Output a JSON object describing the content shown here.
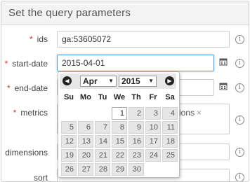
{
  "panel": {
    "title": "Set the query parameters"
  },
  "rows": {
    "ids": {
      "label": "ids",
      "value": "ga:53605072"
    },
    "start_date": {
      "label": "start-date",
      "value": "2015-04-01"
    },
    "end_date": {
      "label": "end-date",
      "value": ""
    },
    "metrics": {
      "label": "metrics",
      "chip": "ions",
      "chip_remove": "×"
    },
    "dimensions": {
      "label": "dimensions",
      "value": ""
    },
    "sort": {
      "label": "sort",
      "value": ""
    }
  },
  "required_marker": "*",
  "info_glyph": "i",
  "calendar_icon": "calendar-icon",
  "datepicker": {
    "month": "Apr",
    "year": "2015",
    "prev": "◀",
    "next": "▶",
    "dropdown_arrow": "▼",
    "weekdays": [
      "Su",
      "Mo",
      "Tu",
      "We",
      "Th",
      "Fr",
      "Sa"
    ],
    "selected_day": "1",
    "days": [
      "1",
      "2",
      "3",
      "4",
      "5",
      "6",
      "7",
      "8",
      "9",
      "10",
      "11",
      "12",
      "13",
      "14",
      "15",
      "16",
      "17",
      "18",
      "19",
      "20",
      "21",
      "22",
      "23",
      "24",
      "25",
      "26",
      "27",
      "28",
      "29",
      "30"
    ]
  },
  "colors": {
    "required": "#c0392b",
    "focus": "#5b9bd5"
  }
}
